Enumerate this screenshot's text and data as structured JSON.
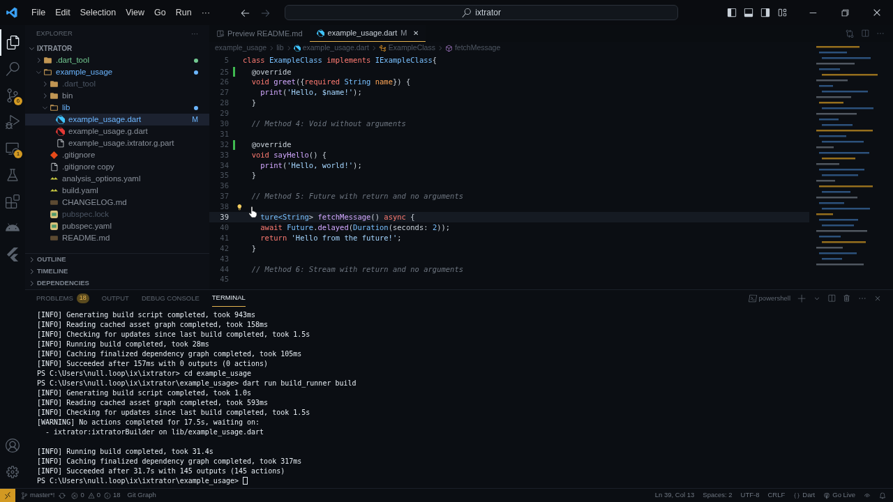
{
  "title_bar": {
    "menus": [
      "File",
      "Edit",
      "Selection",
      "View",
      "Go",
      "Run",
      "···"
    ],
    "search": "ixtrator"
  },
  "activity_bar": {
    "items": [
      {
        "kind": "files",
        "selected": true
      },
      {
        "kind": "search",
        "selected": false
      },
      {
        "kind": "scm",
        "selected": false,
        "badge": "6"
      },
      {
        "kind": "debug",
        "selected": false
      },
      {
        "kind": "remote",
        "selected": false,
        "badge": "1"
      },
      {
        "kind": "testing",
        "selected": false
      },
      {
        "kind": "extensions",
        "selected": false
      },
      {
        "kind": "android",
        "selected": false
      },
      {
        "kind": "flutter",
        "selected": false
      }
    ],
    "bottom": [
      {
        "kind": "account"
      },
      {
        "kind": "settings"
      }
    ]
  },
  "sidebar": {
    "title": "EXPLORER",
    "more": "···",
    "root": {
      "label": "IXTRATOR",
      "expanded": true
    },
    "tree": [
      {
        "label": ".dart_tool",
        "kind": "folder",
        "color": "#73c991",
        "selected": false,
        "dot": true,
        "expanded": false
      },
      {
        "label": "example_usage",
        "kind": "folder",
        "color": "#6cb6ff",
        "selected": false,
        "dot": true,
        "expanded": true,
        "children": [
          {
            "label": ".dart_tool",
            "kind": "folder",
            "color": "#4b5563",
            "selected": false,
            "dot": false,
            "expanded": false
          },
          {
            "label": "bin",
            "kind": "folder",
            "color": "#8b929c",
            "selected": false,
            "dot": false,
            "expanded": false
          },
          {
            "label": "lib",
            "kind": "folder",
            "color": "#6cb6ff",
            "selected": false,
            "dot": true,
            "expanded": true,
            "children": [
              {
                "label": "example_usage.dart",
                "kind": "dart",
                "color": "#6cb6ff",
                "selected": true,
                "dot": false,
                "badge": "M"
              },
              {
                "label": "example_usage.g.dart",
                "kind": "dart-gen",
                "color": "#8b929c",
                "selected": false,
                "dot": false
              },
              {
                "label": "example_usage.ixtrator.g.part",
                "kind": "file",
                "color": "#8b929c",
                "selected": false,
                "dot": false
              }
            ]
          },
          {
            "label": ".gitignore",
            "kind": "git",
            "color": "#8b929c",
            "selected": false,
            "dot": false
          },
          {
            "label": ".gitignore copy",
            "kind": "file",
            "color": "#8b929c",
            "selected": false,
            "dot": false
          },
          {
            "label": "analysis_options.yaml",
            "kind": "yaml",
            "color": "#8b929c",
            "selected": false,
            "dot": false
          },
          {
            "label": "build.yaml",
            "kind": "yaml",
            "color": "#8b929c",
            "selected": false,
            "dot": false
          },
          {
            "label": "CHANGELOG.md",
            "kind": "markdown",
            "color": "#8b929c",
            "selected": false,
            "dot": false
          },
          {
            "label": "pubspec.lock",
            "kind": "pubspec",
            "color": "#4b5563",
            "selected": false,
            "dot": false
          },
          {
            "label": "pubspec.yaml",
            "kind": "pubspec",
            "color": "#8b929c",
            "selected": false,
            "dot": false
          },
          {
            "label": "README.md",
            "kind": "markdown",
            "color": "#8b929c",
            "selected": false,
            "dot": false
          }
        ]
      }
    ],
    "sections": [
      {
        "label": "OUTLINE",
        "expanded": false
      },
      {
        "label": "TIMELINE",
        "expanded": false
      },
      {
        "label": "DEPENDENCIES",
        "expanded": false
      }
    ]
  },
  "editor": {
    "tabs": [
      {
        "label": "Preview README.md",
        "kind": "preview",
        "selected": false
      },
      {
        "label": "example_usage.dart",
        "kind": "dart",
        "selected": true,
        "badge": "M",
        "close": "✕"
      }
    ],
    "breadcrumbs": [
      {
        "label": "example_usage",
        "kind": "text"
      },
      {
        "label": "lib",
        "kind": "text"
      },
      {
        "label": "example_usage.dart",
        "kind": "dart"
      },
      {
        "label": "ExampleClass",
        "kind": "class"
      },
      {
        "label": "fetchMessage",
        "kind": "method"
      }
    ],
    "lines": [
      {
        "n": "5",
        "changed": false,
        "current": false,
        "lightbulb": false,
        "tokens": [
          {
            "text": "class ",
            "kind": "keyword"
          },
          {
            "text": "ExampleClass ",
            "kind": "type"
          },
          {
            "text": "implements ",
            "kind": "keyword"
          },
          {
            "text": "IExampleClass",
            "kind": "type"
          },
          {
            "text": "{",
            "kind": "punctuation"
          }
        ]
      },
      {
        "n": "25",
        "changed": true,
        "current": false,
        "lightbulb": false,
        "tokens": [
          {
            "text": "  @override",
            "kind": "annotation"
          }
        ]
      },
      {
        "n": "26",
        "changed": false,
        "current": false,
        "lightbulb": false,
        "tokens": [
          {
            "text": "  void ",
            "kind": "keyword"
          },
          {
            "text": "greet",
            "kind": "function"
          },
          {
            "text": "({",
            "kind": "punctuation"
          },
          {
            "text": "required ",
            "kind": "keyword"
          },
          {
            "text": "String",
            "kind": "type"
          },
          {
            "text": " name",
            "kind": "parameter"
          },
          {
            "text": "}) {",
            "kind": "punctuation"
          }
        ]
      },
      {
        "n": "27",
        "changed": false,
        "current": false,
        "lightbulb": false,
        "tokens": [
          {
            "text": "    print",
            "kind": "function"
          },
          {
            "text": "(",
            "kind": "punctuation"
          },
          {
            "text": "'Hello, $name!'",
            "kind": "string"
          },
          {
            "text": ");",
            "kind": "punctuation"
          }
        ]
      },
      {
        "n": "28",
        "changed": false,
        "current": false,
        "lightbulb": false,
        "tokens": [
          {
            "text": "  }",
            "kind": "punctuation"
          }
        ]
      },
      {
        "n": "29",
        "changed": false,
        "current": false,
        "lightbulb": false
      },
      {
        "n": "30",
        "changed": false,
        "current": false,
        "lightbulb": false,
        "tokens": [
          {
            "text": "  // Method 4: Void without arguments",
            "kind": "comment"
          }
        ]
      },
      {
        "n": "31",
        "changed": false,
        "current": false,
        "lightbulb": false
      },
      {
        "n": "32",
        "changed": true,
        "current": false,
        "lightbulb": false,
        "tokens": [
          {
            "text": "  @override",
            "kind": "annotation"
          }
        ]
      },
      {
        "n": "33",
        "changed": false,
        "current": false,
        "lightbulb": false,
        "tokens": [
          {
            "text": "  void ",
            "kind": "keyword"
          },
          {
            "text": "sayHello",
            "kind": "function"
          },
          {
            "text": "() {",
            "kind": "punctuation"
          }
        ]
      },
      {
        "n": "34",
        "changed": false,
        "current": false,
        "lightbulb": false,
        "tokens": [
          {
            "text": "    print",
            "kind": "function"
          },
          {
            "text": "(",
            "kind": "punctuation"
          },
          {
            "text": "'Hello, world!'",
            "kind": "string"
          },
          {
            "text": ");",
            "kind": "punctuation"
          }
        ]
      },
      {
        "n": "35",
        "changed": false,
        "current": false,
        "lightbulb": false,
        "tokens": [
          {
            "text": "  }",
            "kind": "punctuation"
          }
        ]
      },
      {
        "n": "36",
        "changed": false,
        "current": false,
        "lightbulb": false
      },
      {
        "n": "37",
        "changed": false,
        "current": false,
        "lightbulb": false,
        "tokens": [
          {
            "text": "  // Method 5: Future with return and no arguments",
            "kind": "comment"
          }
        ]
      },
      {
        "n": "38",
        "changed": false,
        "current": false,
        "lightbulb": true
      },
      {
        "n": "39",
        "changed": false,
        "current": true,
        "lightbulb": false,
        "tokens": [
          {
            "text": "    ture<",
            "kind": "type"
          },
          {
            "text": "String",
            "kind": "type"
          },
          {
            "text": "> ",
            "kind": "punctuation"
          },
          {
            "text": "fetchMessage",
            "kind": "function"
          },
          {
            "text": "() ",
            "kind": "punctuation"
          },
          {
            "text": "async ",
            "kind": "keyword"
          },
          {
            "text": "{",
            "kind": "punctuation"
          }
        ]
      },
      {
        "n": "40",
        "changed": false,
        "current": false,
        "lightbulb": false,
        "tokens": [
          {
            "text": "    await ",
            "kind": "keyword"
          },
          {
            "text": "Future",
            "kind": "type"
          },
          {
            "text": ".",
            "kind": "punctuation"
          },
          {
            "text": "delayed",
            "kind": "function"
          },
          {
            "text": "(",
            "kind": "punctuation"
          },
          {
            "text": "Duration",
            "kind": "type"
          },
          {
            "text": "(seconds: ",
            "kind": "punctuation"
          },
          {
            "text": "2",
            "kind": "number"
          },
          {
            "text": "));",
            "kind": "punctuation"
          }
        ]
      },
      {
        "n": "41",
        "changed": false,
        "current": false,
        "lightbulb": false,
        "tokens": [
          {
            "text": "    return ",
            "kind": "keyword"
          },
          {
            "text": "'Hello from the future!'",
            "kind": "string"
          },
          {
            "text": ";",
            "kind": "punctuation"
          }
        ]
      },
      {
        "n": "42",
        "changed": false,
        "current": false,
        "lightbulb": false,
        "tokens": [
          {
            "text": "  }",
            "kind": "punctuation"
          }
        ]
      },
      {
        "n": "43",
        "changed": false,
        "current": false,
        "lightbulb": false
      },
      {
        "n": "44",
        "changed": false,
        "current": false,
        "lightbulb": false,
        "tokens": [
          {
            "text": "  // Method 6: Stream with return and no arguments",
            "kind": "comment"
          }
        ]
      },
      {
        "n": "45",
        "changed": false,
        "current": false,
        "lightbulb": false
      }
    ]
  },
  "panel": {
    "tabs": [
      {
        "label": "PROBLEMS",
        "selected": false,
        "badge": "18"
      },
      {
        "label": "OUTPUT",
        "selected": false
      },
      {
        "label": "DEBUG CONSOLE",
        "selected": false
      },
      {
        "label": "TERMINAL",
        "selected": true
      }
    ],
    "shell": "powershell",
    "terminal": [
      {
        "kind": "output",
        "text": "[INFO] Generating build script completed, took 943ms"
      },
      {
        "kind": "output",
        "text": "[INFO] Reading cached asset graph completed, took 158ms"
      },
      {
        "kind": "output",
        "text": "[INFO] Checking for updates since last build completed, took 1.5s"
      },
      {
        "kind": "output",
        "text": "[INFO] Running build completed, took 28ms"
      },
      {
        "kind": "output",
        "text": "[INFO] Caching finalized dependency graph completed, took 105ms"
      },
      {
        "kind": "output",
        "text": "[INFO] Succeeded after 157ms with 0 outputs (0 actions)"
      },
      {
        "kind": "output",
        "text": "PS C:\\Users\\null.loop\\ix\\ixtrator> cd example_usage"
      },
      {
        "kind": "output",
        "text": "PS C:\\Users\\null.loop\\ix\\ixtrator\\example_usage> dart run build_runner build"
      },
      {
        "kind": "output",
        "text": "[INFO] Generating build script completed, took 1.0s"
      },
      {
        "kind": "output",
        "text": "[INFO] Reading cached asset graph completed, took 593ms"
      },
      {
        "kind": "output",
        "text": "[INFO] Checking for updates since last build completed, took 1.5s"
      },
      {
        "kind": "output",
        "text": "[WARNING] No actions completed for 17.5s, waiting on:"
      },
      {
        "kind": "output",
        "text": "  - ixtrator:ixtratorBuilder on lib/example_usage.dart"
      },
      {
        "kind": "blank"
      },
      {
        "kind": "output",
        "text": "[INFO] Running build completed, took 31.4s"
      },
      {
        "kind": "output",
        "text": "[INFO] Caching finalized dependency graph completed, took 317ms"
      },
      {
        "kind": "output",
        "text": "[INFO] Succeeded after 31.7s with 145 outputs (145 actions)"
      },
      {
        "kind": "input",
        "text": "PS C:\\Users\\null.loop\\ix\\ixtrator\\example_usage>"
      }
    ]
  },
  "status_bar": {
    "branch": "master*!",
    "errors": "0",
    "warnings": "0",
    "infos": "18",
    "git_graph": "Git Graph",
    "position": "Ln 39, Col 13",
    "spaces": "Spaces: 2",
    "encoding": "UTF-8",
    "eol": "CRLF",
    "language": "Dart",
    "go_live": "Go Live"
  }
}
